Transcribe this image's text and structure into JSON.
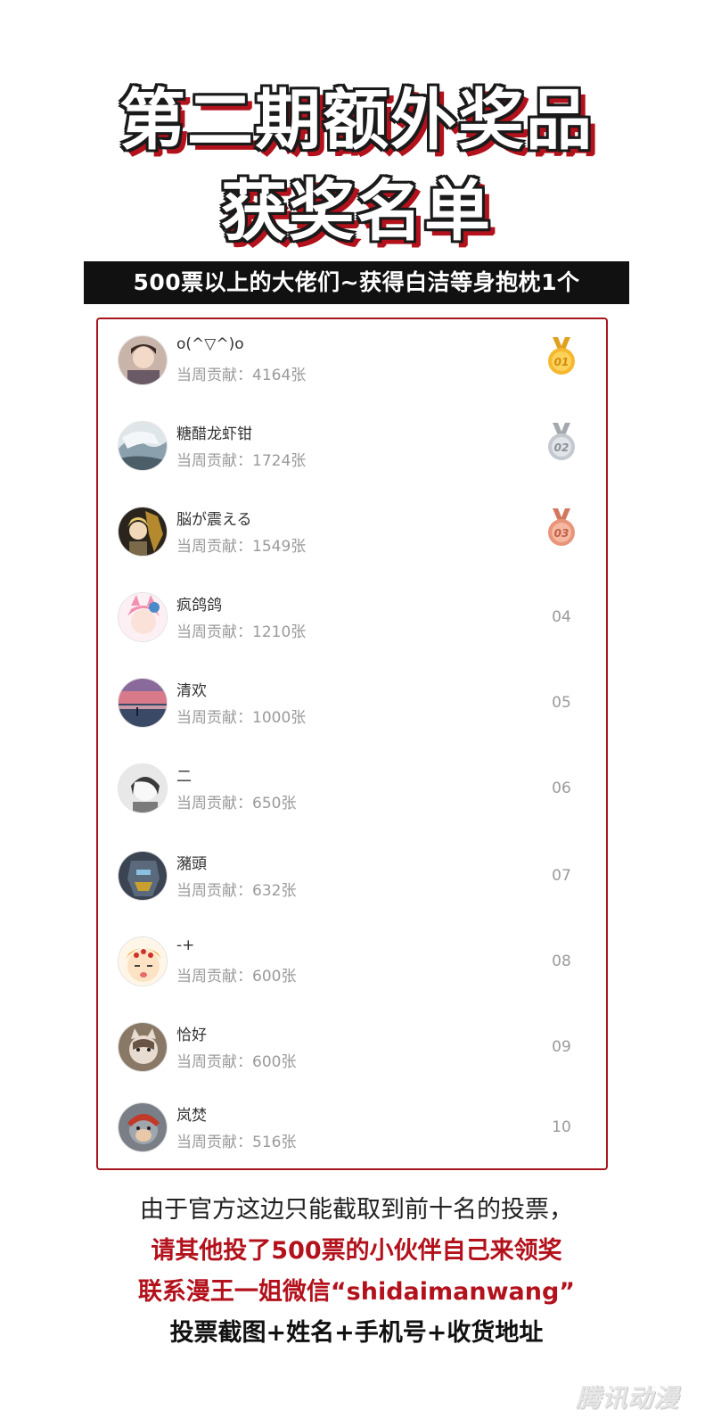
{
  "header": {
    "title_line1": "第二期额外奖品",
    "title_line2": "获奖名单",
    "subtitle": "500票以上的大佬们~获得白洁等身抱枕1个"
  },
  "contribution_label": "当周贡献：",
  "ranking": [
    {
      "rank": "01",
      "name": "o(^▽^)o",
      "count": "4164张",
      "medal": "gold",
      "avatar": "avatar-photo-portrait"
    },
    {
      "rank": "02",
      "name": "糖醋龙虾钳",
      "count": "1724张",
      "medal": "silver",
      "avatar": "avatar-painting-landscape"
    },
    {
      "rank": "03",
      "name": "脳が震える",
      "count": "1549张",
      "medal": "bronze",
      "avatar": "avatar-anime-character"
    },
    {
      "rank": "04",
      "name": "疯鸽鸽",
      "count": "1210张",
      "medal": "",
      "avatar": "avatar-pink-anime"
    },
    {
      "rank": "05",
      "name": "清欢",
      "count": "1000张",
      "medal": "",
      "avatar": "avatar-sunset-scene"
    },
    {
      "rank": "06",
      "name": "二",
      "count": "650张",
      "medal": "",
      "avatar": "avatar-gray-sketch"
    },
    {
      "rank": "07",
      "name": "瀦頭",
      "count": "632张",
      "medal": "",
      "avatar": "avatar-robot"
    },
    {
      "rank": "08",
      "name": "-+",
      "count": "600张",
      "medal": "",
      "avatar": "avatar-cartoon-face"
    },
    {
      "rank": "09",
      "name": "恰好",
      "count": "600张",
      "medal": "",
      "avatar": "avatar-cat"
    },
    {
      "rank": "10",
      "name": "岚焚",
      "count": "516张",
      "medal": "",
      "avatar": "avatar-monkey-king"
    }
  ],
  "footer": {
    "line1": "由于官方这边只能截取到前十名的投票，",
    "line2": "请其他投了500票的小伙伴自己来领奖",
    "line3": "联系漫王一姐微信“shidaimanwang”",
    "line4": "投票截图+姓名+手机号+收货地址"
  },
  "watermark": "腾讯动漫",
  "colors": {
    "accent_red": "#b3121c",
    "banner_black": "#111111",
    "gold": "#f5b82e",
    "silver": "#c4c8cf",
    "bronze": "#e8957a"
  }
}
